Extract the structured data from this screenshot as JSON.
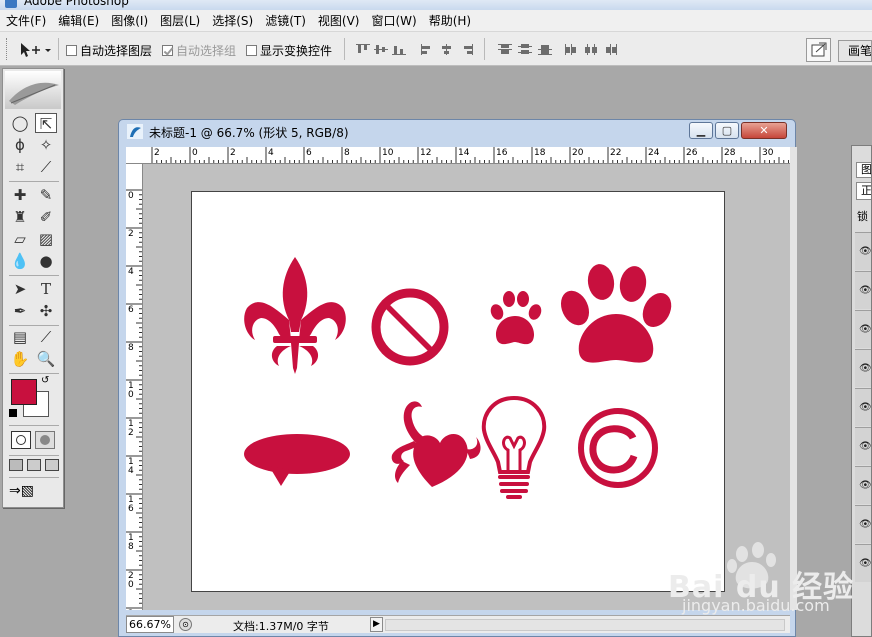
{
  "app": {
    "title": "Adobe Photoshop"
  },
  "menu": [
    "文件(F)",
    "编辑(E)",
    "图像(I)",
    "图层(L)",
    "选择(S)",
    "滤镜(T)",
    "视图(V)",
    "窗口(W)",
    "帮助(H)"
  ],
  "options": {
    "auto_select_layer": "自动选择图层",
    "auto_select_group": "自动选择组",
    "show_transform_controls": "显示变换控件",
    "auto_select_layer_checked": false,
    "auto_select_group_checked": true,
    "show_transform_controls_checked": false
  },
  "document": {
    "title": "未标题-1 @ 66.7% (形状 5, RGB/8)",
    "zoom": "66.67%",
    "status": "文档:1.37M/0 字节",
    "h_ruler_labels": [
      "2",
      "0",
      "2",
      "4",
      "6",
      "8",
      "10",
      "12",
      "14",
      "16",
      "18",
      "20",
      "22",
      "24",
      "26",
      "28",
      "30"
    ],
    "v_ruler_labels": [
      "0",
      "2",
      "4",
      "6",
      "8",
      "10",
      "12",
      "14",
      "16",
      "18",
      "20",
      "2"
    ],
    "shape_color": "#c8103e",
    "shapes": [
      "fleur-de-lis",
      "no-symbol",
      "small-paw",
      "large-paw",
      "speech-bubble",
      "decorative-heart",
      "light-bulb",
      "copyright-symbol"
    ]
  },
  "toolbox": {
    "foreground_color": "#c8103e",
    "background_color": "#ffffff"
  },
  "panels": {
    "right_tab_label": "画笔",
    "layers_tab_label": "图",
    "layers_mode_label": "正",
    "layers_lock_label": "锁"
  },
  "watermark": {
    "brand": "Bai du 经验",
    "url": "jingyan.baidu.com"
  }
}
